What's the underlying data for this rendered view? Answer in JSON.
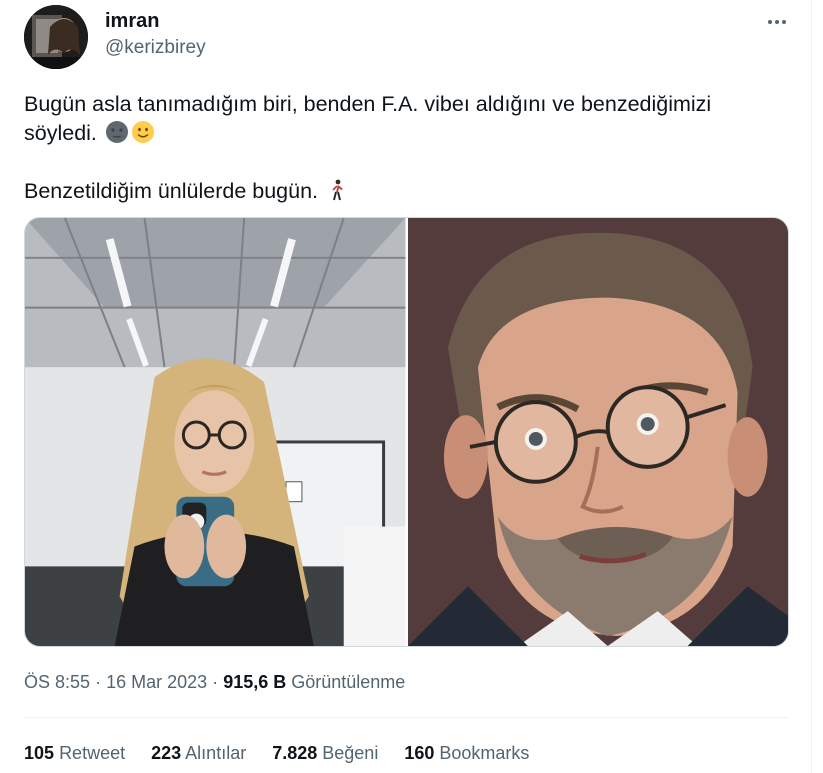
{
  "user": {
    "name": "imran",
    "handle": "@kerizbirey"
  },
  "tweet": {
    "line1": "Bugün asla tanımadığım biri, benden F.A. vibeı aldığını ve benzediğimizi söyledi.",
    "line2": "Benzetildiğim ünlülerde bugün.",
    "emojis": [
      "new-moon-face-emoji",
      "slightly-smiling-face-emoji",
      "person-walking-emoji"
    ]
  },
  "meta": {
    "time": "ÖS 8:55",
    "date": "16 Mar 2023",
    "separator": "·",
    "views_count": "915,6 B",
    "views_label": "Görüntülenme"
  },
  "stats": {
    "retweets_count": "105",
    "retweets_label": "Retweet",
    "quotes_count": "223",
    "quotes_label": "Alıntılar",
    "likes_count": "7.828",
    "likes_label": "Beğeni",
    "bookmarks_count": "160",
    "bookmarks_label": "Bookmarks"
  },
  "colors": {
    "text": "#0f1419",
    "secondary": "#536471",
    "border": "#eff3f4"
  }
}
